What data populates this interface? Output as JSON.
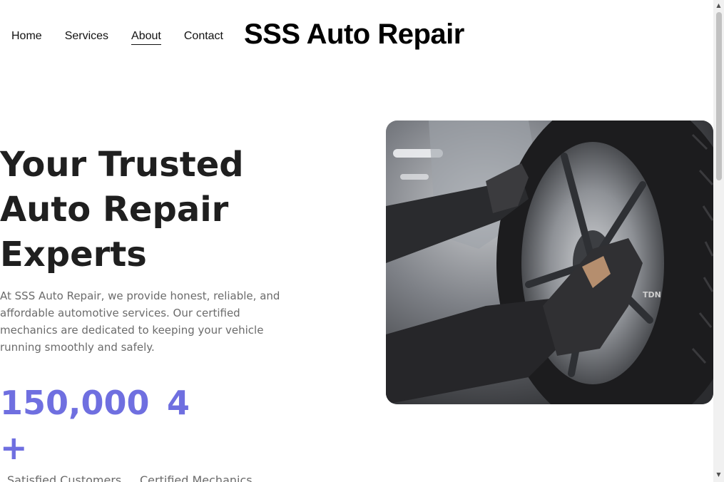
{
  "nav": {
    "items": [
      {
        "label": "Home"
      },
      {
        "label": "Services"
      },
      {
        "label": "About",
        "active": true
      },
      {
        "label": "Contact"
      }
    ]
  },
  "brand": {
    "title": "SSS Auto Repair"
  },
  "hero": {
    "title": "Your Trusted Auto Repair Experts",
    "description": "At SSS Auto Repair, we provide honest, reliable, and affordable automotive services. Our certified mechanics are dedicated to keeping your vehicle running smoothly and safely.",
    "image_icon": "mechanic-tire-photo"
  },
  "stats": [
    {
      "value": "150,000 +",
      "label": "Satisfied Customers"
    },
    {
      "value": "4",
      "label": "Certified Mechanics"
    }
  ],
  "colors": {
    "accent": "#6f6fe0",
    "heading": "#1f1f1f",
    "body_text": "#6b6b6b"
  }
}
